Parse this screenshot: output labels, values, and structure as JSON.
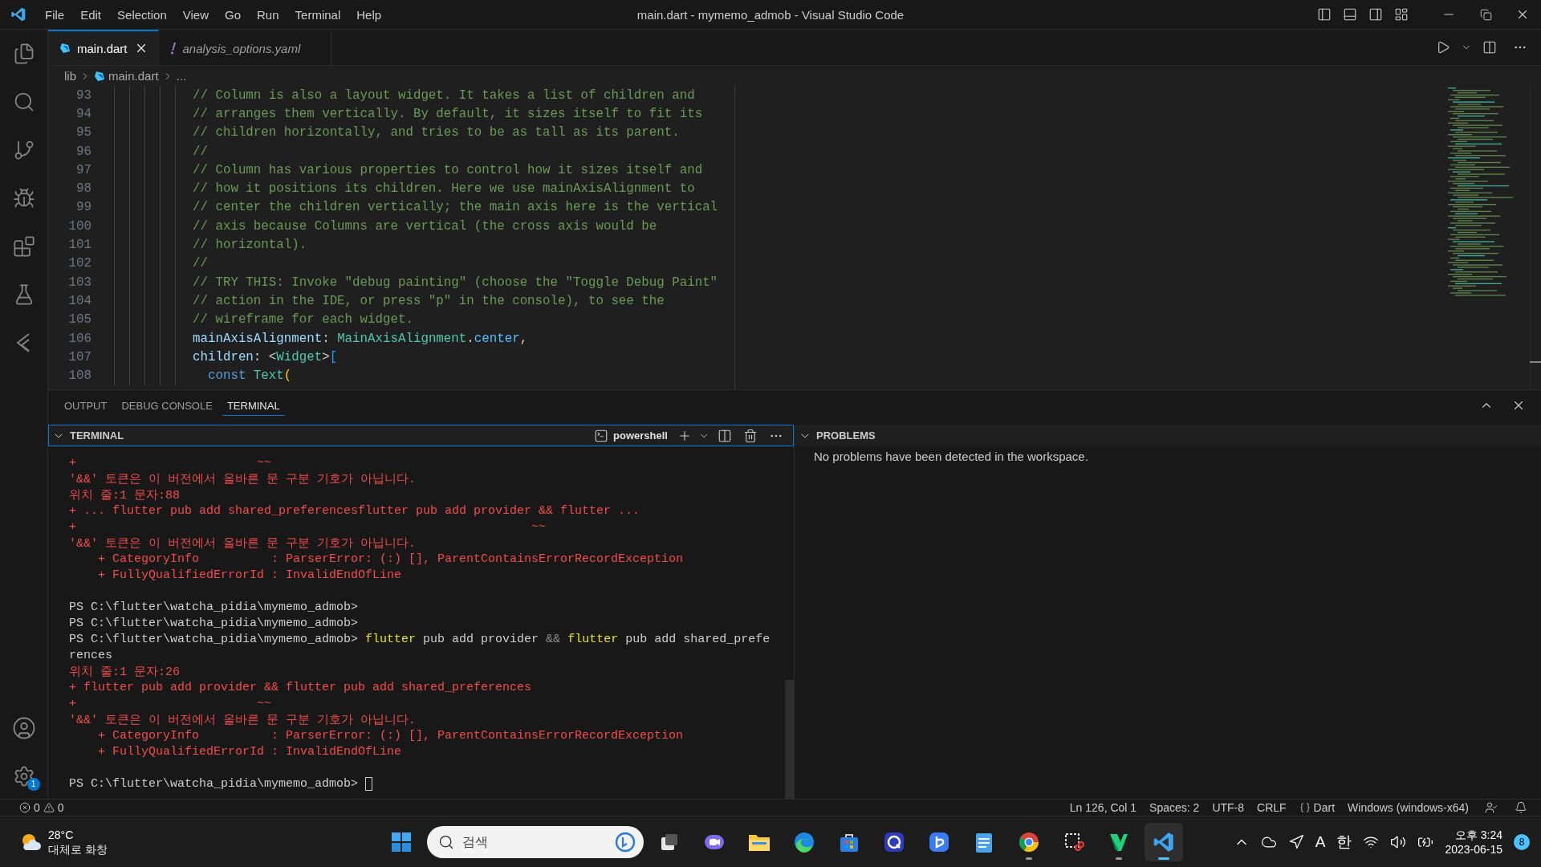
{
  "window": {
    "title": "main.dart - mymemo_admob - Visual Studio Code"
  },
  "menu": [
    "File",
    "Edit",
    "Selection",
    "View",
    "Go",
    "Run",
    "Terminal",
    "Help"
  ],
  "activity_bar": {
    "settings_badge": "1"
  },
  "editor_tabs": [
    {
      "label": "main.dart",
      "kind": "dart",
      "selected": true
    },
    {
      "label": "analysis_options.yaml",
      "kind": "yaml",
      "selected": false
    }
  ],
  "breadcrumb": [
    {
      "label": "lib",
      "kind": "folder"
    },
    {
      "label": "main.dart",
      "kind": "dart"
    },
    {
      "label": "...",
      "kind": "more"
    }
  ],
  "code_lines": [
    {
      "number": "93",
      "tokens": [
        {
          "kind": "comment",
          "text": "// Column is also a layout widget. It takes a list of children and"
        }
      ]
    },
    {
      "number": "94",
      "tokens": [
        {
          "kind": "comment",
          "text": "// arranges them vertically. By default, it sizes itself to fit its"
        }
      ]
    },
    {
      "number": "95",
      "tokens": [
        {
          "kind": "comment",
          "text": "// children horizontally, and tries to be as tall as its parent."
        }
      ]
    },
    {
      "number": "96",
      "tokens": [
        {
          "kind": "comment",
          "text": "//"
        }
      ]
    },
    {
      "number": "97",
      "tokens": [
        {
          "kind": "comment",
          "text": "// Column has various properties to control how it sizes itself and"
        }
      ]
    },
    {
      "number": "98",
      "tokens": [
        {
          "kind": "comment",
          "text": "// how it positions its children. Here we use mainAxisAlignment to"
        }
      ]
    },
    {
      "number": "99",
      "tokens": [
        {
          "kind": "comment",
          "text": "// center the children vertically; the main axis here is the vertical"
        }
      ]
    },
    {
      "number": "100",
      "tokens": [
        {
          "kind": "comment",
          "text": "// axis because Columns are vertical (the cross axis would be"
        }
      ]
    },
    {
      "number": "101",
      "tokens": [
        {
          "kind": "comment",
          "text": "// horizontal)."
        }
      ]
    },
    {
      "number": "102",
      "tokens": [
        {
          "kind": "comment",
          "text": "//"
        }
      ]
    },
    {
      "number": "103",
      "tokens": [
        {
          "kind": "comment",
          "text": "// TRY THIS: Invoke \"debug painting\" (choose the \"Toggle Debug Paint\""
        }
      ]
    },
    {
      "number": "104",
      "tokens": [
        {
          "kind": "comment",
          "text": "// action in the IDE, or press \"p\" in the console), to see the"
        }
      ]
    },
    {
      "number": "105",
      "tokens": [
        {
          "kind": "comment",
          "text": "// wireframe for each widget."
        }
      ]
    },
    {
      "number": "106",
      "tokens": [
        {
          "kind": "property",
          "text": "mainAxisAlignment"
        },
        {
          "kind": "punct",
          "text": ": "
        },
        {
          "kind": "type",
          "text": "MainAxisAlignment"
        },
        {
          "kind": "punct",
          "text": "."
        },
        {
          "kind": "enum",
          "text": "center"
        },
        {
          "kind": "punct",
          "text": ","
        }
      ]
    },
    {
      "number": "107",
      "tokens": [
        {
          "kind": "property",
          "text": "children"
        },
        {
          "kind": "punct",
          "text": ": <"
        },
        {
          "kind": "type",
          "text": "Widget"
        },
        {
          "kind": "punct",
          "text": ">"
        },
        {
          "kind": "bracket",
          "text": "["
        }
      ]
    },
    {
      "number": "108",
      "tokens": [
        {
          "kind": "keyword",
          "text": "  const"
        },
        {
          "kind": "type",
          "text": " Text"
        },
        {
          "kind": "bracket2",
          "text": "("
        }
      ]
    }
  ],
  "panel": {
    "tabs": [
      {
        "label": "OUTPUT",
        "selected": false
      },
      {
        "label": "DEBUG CONSOLE",
        "selected": false
      },
      {
        "label": "TERMINAL",
        "selected": true
      }
    ],
    "terminal": {
      "title": "TERMINAL",
      "shell": "powershell",
      "lines": [
        {
          "kind": "text",
          "segments": [
            {
              "kind": "error",
              "text": "+                         ~~"
            }
          ]
        },
        {
          "kind": "text",
          "segments": [
            {
              "kind": "error",
              "text": "'&&' 토큰은 이 버전에서 올바른 문 구분 기호가 아닙니다."
            }
          ]
        },
        {
          "kind": "text",
          "segments": [
            {
              "kind": "error",
              "text": "위치 줄:1 문자:88"
            }
          ]
        },
        {
          "kind": "text",
          "segments": [
            {
              "kind": "error",
              "text": "+ ... flutter pub add shared_preferencesflutter pub add provider && flutter ..."
            }
          ]
        },
        {
          "kind": "text",
          "segments": [
            {
              "kind": "error",
              "text": "+                                                               ~~"
            }
          ]
        },
        {
          "kind": "text",
          "segments": [
            {
              "kind": "error",
              "text": "'&&' 토큰은 이 버전에서 올바른 문 구분 기호가 아닙니다."
            }
          ]
        },
        {
          "kind": "text",
          "segments": [
            {
              "kind": "error",
              "text": "    + CategoryInfo          : ParserError: (:) [], ParentContainsErrorRecordException"
            }
          ]
        },
        {
          "kind": "text",
          "segments": [
            {
              "kind": "error",
              "text": "    + FullyQualifiedErrorId : InvalidEndOfLine"
            }
          ]
        },
        {
          "kind": "blank"
        },
        {
          "kind": "text",
          "segments": [
            {
              "kind": "plain",
              "text": "PS C:\\flutter\\watcha_pidia\\mymemo_admob>"
            }
          ]
        },
        {
          "kind": "text",
          "segments": [
            {
              "kind": "plain",
              "text": "PS C:\\flutter\\watcha_pidia\\mymemo_admob>"
            }
          ]
        },
        {
          "kind": "text",
          "segments": [
            {
              "kind": "plain",
              "text": "PS C:\\flutter\\watcha_pidia\\mymemo_admob> "
            },
            {
              "kind": "command",
              "text": "flutter"
            },
            {
              "kind": "plain",
              "text": " pub add provider "
            },
            {
              "kind": "operator",
              "text": "&&"
            },
            {
              "kind": "command",
              "text": " flutter"
            },
            {
              "kind": "plain",
              "text": " pub add shared_prefe"
            }
          ]
        },
        {
          "kind": "text",
          "segments": [
            {
              "kind": "plain",
              "text": "rences"
            }
          ]
        },
        {
          "kind": "text",
          "segments": [
            {
              "kind": "error",
              "text": "위치 줄:1 문자:26"
            }
          ]
        },
        {
          "kind": "text",
          "segments": [
            {
              "kind": "error",
              "text": "+ flutter pub add provider && flutter pub add shared_preferences"
            }
          ]
        },
        {
          "kind": "text",
          "segments": [
            {
              "kind": "error",
              "text": "+                         ~~"
            }
          ]
        },
        {
          "kind": "text",
          "segments": [
            {
              "kind": "error",
              "text": "'&&' 토큰은 이 버전에서 올바른 문 구분 기호가 아닙니다."
            }
          ]
        },
        {
          "kind": "text",
          "segments": [
            {
              "kind": "error",
              "text": "    + CategoryInfo          : ParserError: (:) [], ParentContainsErrorRecordException"
            }
          ]
        },
        {
          "kind": "text",
          "segments": [
            {
              "kind": "error",
              "text": "    + FullyQualifiedErrorId : InvalidEndOfLine"
            }
          ]
        },
        {
          "kind": "blank"
        },
        {
          "kind": "prompt",
          "segments": [
            {
              "kind": "plain",
              "text": "PS C:\\flutter\\watcha_pidia\\mymemo_admob> "
            }
          ]
        }
      ]
    },
    "problems": {
      "title": "PROBLEMS",
      "message": "No problems have been detected in the workspace."
    }
  },
  "status_bar": {
    "errors": "0",
    "warnings": "0",
    "items": [
      {
        "kind": "text",
        "label": "Ln 126, Col 1"
      },
      {
        "kind": "text",
        "label": "Spaces: 2"
      },
      {
        "kind": "text",
        "label": "UTF-8"
      },
      {
        "kind": "text",
        "label": "CRLF"
      },
      {
        "kind": "language",
        "label": "Dart"
      },
      {
        "kind": "text",
        "label": "Windows (windows-x64)"
      }
    ]
  },
  "taskbar": {
    "weather": {
      "temperature": "28°C",
      "condition": "대체로 화창"
    },
    "search": {
      "placeholder": "검색"
    },
    "tray_texts": [
      "A",
      "한"
    ],
    "time": "오후 3:24",
    "date": "2023-06-15",
    "notification_count": "8"
  }
}
